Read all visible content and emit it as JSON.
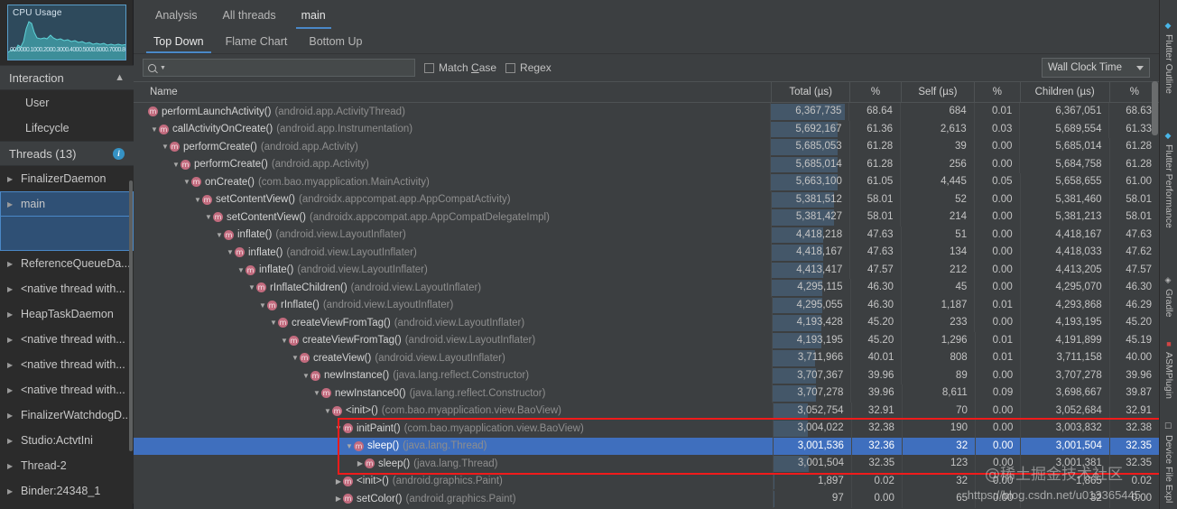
{
  "cpu_panel": {
    "title": "CPU Usage",
    "ticks": [
      "00.00",
      "00.10",
      "00.20",
      "00.30",
      "00.40",
      "00.50",
      "00.60",
      "00.70",
      "00.80"
    ]
  },
  "sidebar": {
    "interaction": {
      "label": "Interaction",
      "collapse_icon": "chevron-up-icon",
      "items": [
        {
          "label": "User"
        },
        {
          "label": "Lifecycle"
        }
      ]
    },
    "threads": {
      "label": "Threads (13)",
      "info_icon": "info-icon",
      "items": [
        {
          "label": "FinalizerDaemon",
          "selected": false
        },
        {
          "label": "main",
          "selected": true
        },
        {
          "label": "ReferenceQueueDa...",
          "selected": false
        },
        {
          "label": "<native thread with...",
          "selected": false
        },
        {
          "label": "HeapTaskDaemon",
          "selected": false
        },
        {
          "label": "<native thread with...",
          "selected": false
        },
        {
          "label": "<native thread with...",
          "selected": false
        },
        {
          "label": "<native thread with...",
          "selected": false
        },
        {
          "label": "FinalizerWatchdogD...",
          "selected": false
        },
        {
          "label": "Studio:ActvtIni",
          "selected": false
        },
        {
          "label": "Thread-2",
          "selected": false
        },
        {
          "label": "Binder:24348_1",
          "selected": false
        }
      ]
    }
  },
  "tabs": [
    {
      "label": "Analysis",
      "active": false
    },
    {
      "label": "All threads",
      "active": false
    },
    {
      "label": "main",
      "active": true
    }
  ],
  "subtabs": [
    {
      "label": "Top Down",
      "active": true
    },
    {
      "label": "Flame Chart",
      "active": false
    },
    {
      "label": "Bottom Up",
      "active": false
    }
  ],
  "filter": {
    "search_value": "",
    "search_placeholder": "",
    "search_icon": "search-icon",
    "match_case_label": "Match Case",
    "regex_label": "Regex",
    "match_case_checked": false,
    "regex_checked": false
  },
  "clock_select": {
    "value": "Wall Clock Time"
  },
  "table": {
    "columns": [
      "Name",
      "Total (µs)",
      "%",
      "Self (µs)",
      "%",
      "Children (µs)",
      "%"
    ],
    "rows": [
      {
        "depth": 0,
        "tri": "none",
        "name": "performLaunchActivity()",
        "pkg": "(android.app.ActivityThread)",
        "total": "6,367,735",
        "pct1": "68.64",
        "self": "684",
        "pct2": "0.01",
        "children": "6,367,051",
        "pct3": "68.63",
        "bar": 95,
        "selected": false
      },
      {
        "depth": 1,
        "tri": "down",
        "name": "callActivityOnCreate()",
        "pkg": "(android.app.Instrumentation)",
        "total": "5,692,167",
        "pct1": "61.36",
        "self": "2,613",
        "pct2": "0.03",
        "children": "5,689,554",
        "pct3": "61.33",
        "bar": 85,
        "selected": false
      },
      {
        "depth": 2,
        "tri": "down",
        "name": "performCreate()",
        "pkg": "(android.app.Activity)",
        "total": "5,685,053",
        "pct1": "61.28",
        "self": "39",
        "pct2": "0.00",
        "children": "5,685,014",
        "pct3": "61.28",
        "bar": 85,
        "selected": false
      },
      {
        "depth": 3,
        "tri": "down",
        "name": "performCreate()",
        "pkg": "(android.app.Activity)",
        "total": "5,685,014",
        "pct1": "61.28",
        "self": "256",
        "pct2": "0.00",
        "children": "5,684,758",
        "pct3": "61.28",
        "bar": 85,
        "selected": false
      },
      {
        "depth": 4,
        "tri": "down",
        "name": "onCreate()",
        "pkg": "(com.bao.myapplication.MainActivity)",
        "total": "5,663,100",
        "pct1": "61.05",
        "self": "4,445",
        "pct2": "0.05",
        "children": "5,658,655",
        "pct3": "61.00",
        "bar": 85,
        "selected": false
      },
      {
        "depth": 5,
        "tri": "down",
        "name": "setContentView()",
        "pkg": "(androidx.appcompat.app.AppCompatActivity)",
        "total": "5,381,512",
        "pct1": "58.01",
        "self": "52",
        "pct2": "0.00",
        "children": "5,381,460",
        "pct3": "58.01",
        "bar": 80,
        "selected": false
      },
      {
        "depth": 6,
        "tri": "down",
        "name": "setContentView()",
        "pkg": "(androidx.appcompat.app.AppCompatDelegateImpl)",
        "total": "5,381,427",
        "pct1": "58.01",
        "self": "214",
        "pct2": "0.00",
        "children": "5,381,213",
        "pct3": "58.01",
        "bar": 80,
        "selected": false
      },
      {
        "depth": 7,
        "tri": "down",
        "name": "inflate()",
        "pkg": "(android.view.LayoutInflater)",
        "total": "4,418,218",
        "pct1": "47.63",
        "self": "51",
        "pct2": "0.00",
        "children": "4,418,167",
        "pct3": "47.63",
        "bar": 66,
        "selected": false
      },
      {
        "depth": 8,
        "tri": "down",
        "name": "inflate()",
        "pkg": "(android.view.LayoutInflater)",
        "total": "4,418,167",
        "pct1": "47.63",
        "self": "134",
        "pct2": "0.00",
        "children": "4,418,033",
        "pct3": "47.62",
        "bar": 66,
        "selected": false
      },
      {
        "depth": 9,
        "tri": "down",
        "name": "inflate()",
        "pkg": "(android.view.LayoutInflater)",
        "total": "4,413,417",
        "pct1": "47.57",
        "self": "212",
        "pct2": "0.00",
        "children": "4,413,205",
        "pct3": "47.57",
        "bar": 66,
        "selected": false
      },
      {
        "depth": 10,
        "tri": "down",
        "name": "rInflateChildren()",
        "pkg": "(android.view.LayoutInflater)",
        "total": "4,295,115",
        "pct1": "46.30",
        "self": "45",
        "pct2": "0.00",
        "children": "4,295,070",
        "pct3": "46.30",
        "bar": 64,
        "selected": false
      },
      {
        "depth": 11,
        "tri": "down",
        "name": "rInflate()",
        "pkg": "(android.view.LayoutInflater)",
        "total": "4,295,055",
        "pct1": "46.30",
        "self": "1,187",
        "pct2": "0.01",
        "children": "4,293,868",
        "pct3": "46.29",
        "bar": 64,
        "selected": false
      },
      {
        "depth": 12,
        "tri": "down",
        "name": "createViewFromTag()",
        "pkg": "(android.view.LayoutInflater)",
        "total": "4,193,428",
        "pct1": "45.20",
        "self": "233",
        "pct2": "0.00",
        "children": "4,193,195",
        "pct3": "45.20",
        "bar": 63,
        "selected": false
      },
      {
        "depth": 13,
        "tri": "down",
        "name": "createViewFromTag()",
        "pkg": "(android.view.LayoutInflater)",
        "total": "4,193,195",
        "pct1": "45.20",
        "self": "1,296",
        "pct2": "0.01",
        "children": "4,191,899",
        "pct3": "45.19",
        "bar": 63,
        "selected": false
      },
      {
        "depth": 14,
        "tri": "down",
        "name": "createView()",
        "pkg": "(android.view.LayoutInflater)",
        "total": "3,711,966",
        "pct1": "40.01",
        "self": "808",
        "pct2": "0.01",
        "children": "3,711,158",
        "pct3": "40.00",
        "bar": 55,
        "selected": false
      },
      {
        "depth": 15,
        "tri": "down",
        "name": "newInstance()",
        "pkg": "(java.lang.reflect.Constructor)",
        "total": "3,707,367",
        "pct1": "39.96",
        "self": "89",
        "pct2": "0.00",
        "children": "3,707,278",
        "pct3": "39.96",
        "bar": 55,
        "selected": false
      },
      {
        "depth": 16,
        "tri": "down",
        "name": "newInstance0()",
        "pkg": "(java.lang.reflect.Constructor)",
        "total": "3,707,278",
        "pct1": "39.96",
        "self": "8,611",
        "pct2": "0.09",
        "children": "3,698,667",
        "pct3": "39.87",
        "bar": 55,
        "selected": false
      },
      {
        "depth": 17,
        "tri": "down",
        "name": "<init>()",
        "pkg": "(com.bao.myapplication.view.BaoView)",
        "total": "3,052,754",
        "pct1": "32.91",
        "self": "70",
        "pct2": "0.00",
        "children": "3,052,684",
        "pct3": "32.91",
        "bar": 45,
        "selected": false
      },
      {
        "depth": 18,
        "tri": "down",
        "name": "initPaint()",
        "pkg": "(com.bao.myapplication.view.BaoView)",
        "total": "3,004,022",
        "pct1": "32.38",
        "self": "190",
        "pct2": "0.00",
        "children": "3,003,832",
        "pct3": "32.38",
        "bar": 45,
        "selected": false
      },
      {
        "depth": 19,
        "tri": "down",
        "name": "sleep()",
        "pkg": "(java.lang.Thread)",
        "total": "3,001,536",
        "pct1": "32.36",
        "self": "32",
        "pct2": "0.00",
        "children": "3,001,504",
        "pct3": "32.35",
        "bar": 45,
        "selected": true
      },
      {
        "depth": 20,
        "tri": "right",
        "name": "sleep()",
        "pkg": "(java.lang.Thread)",
        "total": "3,001,504",
        "pct1": "32.35",
        "self": "123",
        "pct2": "0.00",
        "children": "3,001,381",
        "pct3": "32.35",
        "bar": 45,
        "selected": false
      },
      {
        "depth": 18,
        "tri": "right",
        "name": "<init>()",
        "pkg": "(android.graphics.Paint)",
        "total": "1,897",
        "pct1": "0.02",
        "self": "32",
        "pct2": "0.00",
        "children": "1,865",
        "pct3": "0.02",
        "bar": 1,
        "selected": false
      },
      {
        "depth": 18,
        "tri": "right",
        "name": "setColor()",
        "pkg": "(android.graphics.Paint)",
        "total": "97",
        "pct1": "0.00",
        "self": "65",
        "pct2": "0.00",
        "children": "32",
        "pct3": "0.00",
        "bar": 1,
        "selected": false
      }
    ]
  },
  "right_strip": [
    {
      "label": "Flutter Outline",
      "icon": "flutter-icon"
    },
    {
      "label": "Flutter Performance",
      "icon": "flutter-icon"
    },
    {
      "label": "Gradle",
      "icon": "gradle-icon"
    },
    {
      "label": "ASMPlugin",
      "icon": "asm-icon"
    },
    {
      "label": "Device File Expl",
      "icon": "device-icon"
    }
  ],
  "watermark": {
    "line1": "@稀土掘金技术社区",
    "line2": "https://blog.csdn.net/u013365445"
  },
  "colors": {
    "accent": "#4a88c7",
    "selection": "#3f6fbe",
    "highlight_box": "#f01b1b"
  }
}
